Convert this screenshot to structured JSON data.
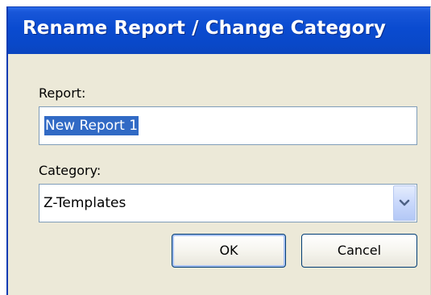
{
  "window": {
    "title": "Rename Report / Change Category"
  },
  "report": {
    "label": "Report:",
    "value": "New Report 1"
  },
  "category": {
    "label": "Category:",
    "selected": "Z-Templates"
  },
  "buttons": {
    "ok": "OK",
    "cancel": "Cancel"
  },
  "icons": {
    "dropdown": "chevron-down-icon"
  },
  "colors": {
    "titlebar": "#0a4bd0",
    "selection": "#316ac5",
    "dialog_bg": "#ece9d8"
  }
}
